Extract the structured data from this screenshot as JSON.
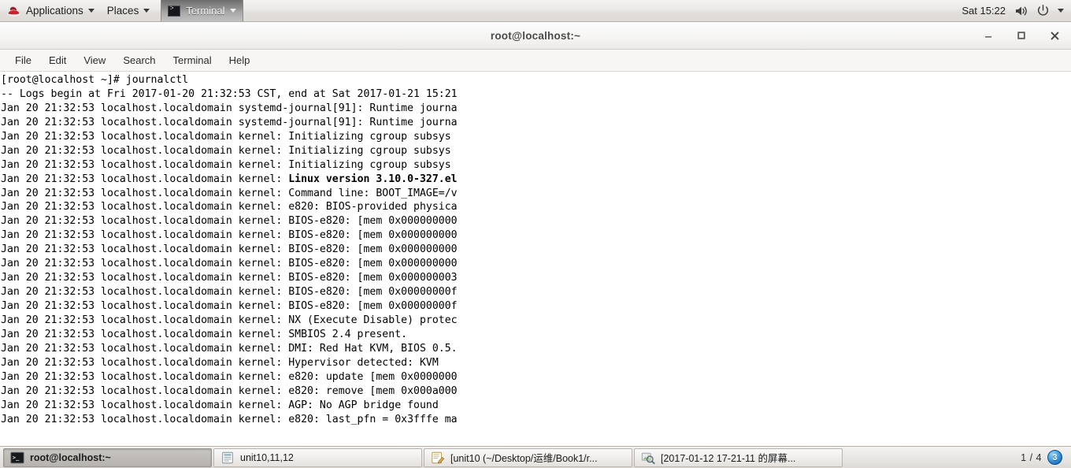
{
  "top_panel": {
    "applications_label": "Applications",
    "places_label": "Places",
    "logo_icon": "redhat-shadowman-icon",
    "window_list": [
      {
        "label": "Terminal",
        "icon": "terminal-icon",
        "active": true
      }
    ],
    "clock": "Sat 15:22",
    "volume_icon": "speaker-volume-icon",
    "power_icon": "power-button-icon",
    "system_caret_icon": "chevron-down-icon"
  },
  "window": {
    "title": "root@localhost:~",
    "controls": {
      "minimize_icon": "minimize-icon",
      "maximize_icon": "maximize-icon",
      "close_icon": "close-icon"
    },
    "menubar": [
      "File",
      "Edit",
      "View",
      "Search",
      "Terminal",
      "Help"
    ]
  },
  "terminal": {
    "prompt_line": "[root@localhost ~]# journalctl",
    "lines": [
      {
        "text": "[root@localhost ~]# journalctl"
      },
      {
        "text": "-- Logs begin at Fri 2017-01-20 21:32:53 CST, end at Sat 2017-01-21 15:21"
      },
      {
        "text": "Jan 20 21:32:53 localhost.localdomain systemd-journal[91]: Runtime journa"
      },
      {
        "text": "Jan 20 21:32:53 localhost.localdomain systemd-journal[91]: Runtime journa"
      },
      {
        "text": "Jan 20 21:32:53 localhost.localdomain kernel: Initializing cgroup subsys"
      },
      {
        "text": "Jan 20 21:32:53 localhost.localdomain kernel: Initializing cgroup subsys"
      },
      {
        "text": "Jan 20 21:32:53 localhost.localdomain kernel: Initializing cgroup subsys"
      },
      {
        "prefix": "Jan 20 21:32:53 localhost.localdomain kernel: ",
        "bold": "Linux version 3.10.0-327.el"
      },
      {
        "text": "Jan 20 21:32:53 localhost.localdomain kernel: Command line: BOOT_IMAGE=/v"
      },
      {
        "text": "Jan 20 21:32:53 localhost.localdomain kernel: e820: BIOS-provided physica"
      },
      {
        "text": "Jan 20 21:32:53 localhost.localdomain kernel: BIOS-e820: [mem 0x000000000"
      },
      {
        "text": "Jan 20 21:32:53 localhost.localdomain kernel: BIOS-e820: [mem 0x000000000"
      },
      {
        "text": "Jan 20 21:32:53 localhost.localdomain kernel: BIOS-e820: [mem 0x000000000"
      },
      {
        "text": "Jan 20 21:32:53 localhost.localdomain kernel: BIOS-e820: [mem 0x000000000"
      },
      {
        "text": "Jan 20 21:32:53 localhost.localdomain kernel: BIOS-e820: [mem 0x000000003"
      },
      {
        "text": "Jan 20 21:32:53 localhost.localdomain kernel: BIOS-e820: [mem 0x00000000f"
      },
      {
        "text": "Jan 20 21:32:53 localhost.localdomain kernel: BIOS-e820: [mem 0x00000000f"
      },
      {
        "text": "Jan 20 21:32:53 localhost.localdomain kernel: NX (Execute Disable) protec"
      },
      {
        "text": "Jan 20 21:32:53 localhost.localdomain kernel: SMBIOS 2.4 present."
      },
      {
        "text": "Jan 20 21:32:53 localhost.localdomain kernel: DMI: Red Hat KVM, BIOS 0.5."
      },
      {
        "text": "Jan 20 21:32:53 localhost.localdomain kernel: Hypervisor detected: KVM"
      },
      {
        "text": "Jan 20 21:32:53 localhost.localdomain kernel: e820: update [mem 0x0000000"
      },
      {
        "text": "Jan 20 21:32:53 localhost.localdomain kernel: e820: remove [mem 0x000a000"
      },
      {
        "text": "Jan 20 21:32:53 localhost.localdomain kernel: AGP: No AGP bridge found"
      },
      {
        "text": "Jan 20 21:32:53 localhost.localdomain kernel: e820: last_pfn = 0x3fffe ma"
      }
    ]
  },
  "taskbar": {
    "tasks": [
      {
        "label": "root@localhost:~",
        "icon": "terminal-icon",
        "active": true
      },
      {
        "label": "unit10,11,12",
        "icon": "document-icon",
        "active": false
      },
      {
        "label": "[unit10 (~/Desktop/运维/Book1/r...",
        "icon": "text-editor-icon",
        "active": false
      },
      {
        "label": "[2017-01-12 17-21-11 的屏幕...",
        "icon": "image-viewer-icon",
        "active": false
      }
    ],
    "workspace_indicator": "1 / 4",
    "workspace_badge": "3"
  },
  "colors": {
    "panel_bg": "#e9e7e4",
    "terminal_bg": "#ffffff",
    "terminal_fg": "#000000",
    "badge_blue": "#1a6fc4",
    "title_fg": "#4b4b4b"
  }
}
